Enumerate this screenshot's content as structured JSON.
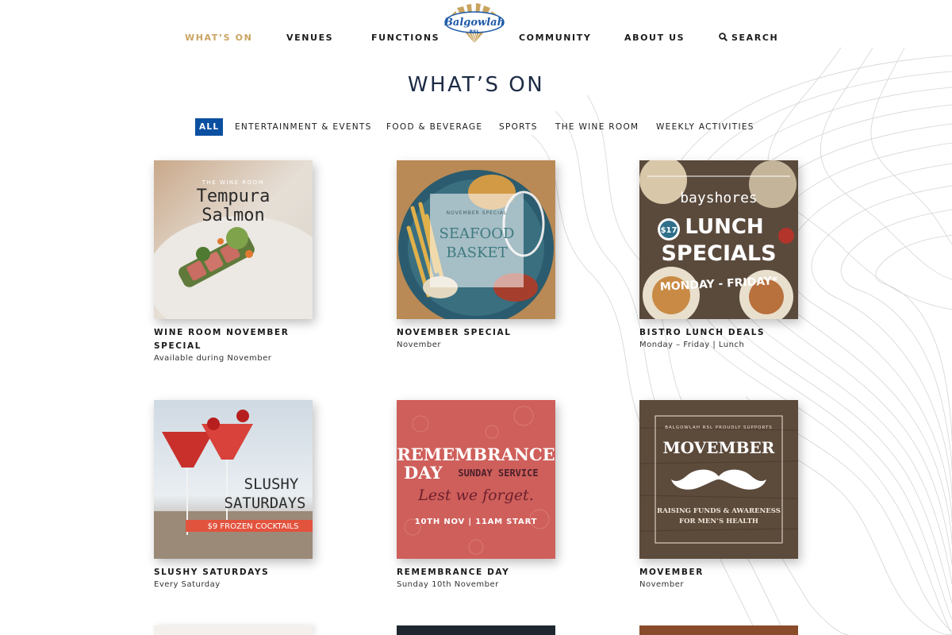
{
  "nav": {
    "items_left": [
      "WHAT’S ON",
      "VENUES",
      "FUNCTIONS"
    ],
    "items_right": [
      "COMMUNITY",
      "ABOUT US"
    ],
    "search_label": "SEARCH",
    "logo_text": "Balgowlah",
    "logo_subtext": "RSL",
    "active_color": "#c9a45f"
  },
  "page": {
    "title": "WHAT’S ON"
  },
  "filters": {
    "items": [
      "ALL",
      "ENTERTAINMENT & EVENTS",
      "FOOD & BEVERAGE",
      "SPORTS",
      "THE WINE ROOM",
      "WEEKLY ACTIVITIES"
    ],
    "active": "ALL",
    "active_color": "#0b4fa0"
  },
  "cards": [
    {
      "title": "WINE ROOM NOVEMBER SPECIAL",
      "subtitle": "Available during November",
      "image": {
        "brand": "THE WINE ROOM",
        "line1": "Tempura",
        "line2": "Salmon"
      }
    },
    {
      "title": "NOVEMBER SPECIAL",
      "subtitle": "November",
      "image": {
        "kicker": "NOVEMBER SPECIAL",
        "line1": "SEAFOOD",
        "line2": "BASKET"
      }
    },
    {
      "title": "BISTRO LUNCH DEALS",
      "subtitle": "Monday – Friday | Lunch",
      "image": {
        "brand": "bayshores",
        "line1": "LUNCH",
        "line2": "SPECIALS",
        "price": "$17",
        "days": "MONDAY - FRIDAY*"
      }
    },
    {
      "title": "SLUSHY SATURDAYS",
      "subtitle": "Every Saturday",
      "image": {
        "line1": "SLUSHY",
        "line2": "SATURDAYS",
        "banner": "$9 FROZEN  COCKTAILS"
      }
    },
    {
      "title": "REMEMBRANCE DAY",
      "subtitle": "Sunday 10th November",
      "image": {
        "line1": "REMEMBRANCE",
        "line2": "DAY",
        "line2b": "SUNDAY SERVICE",
        "script": "Lest we forget.",
        "time": "10TH NOV | 11AM START"
      }
    },
    {
      "title": "MOVEMBER",
      "subtitle": "November",
      "image": {
        "kicker": "BALGOWLAH RSL PROUDLY SUPPORTS",
        "line1": "MOVEMBER",
        "line2": "RAISING FUNDS & AWARENESS",
        "line3": "FOR MEN’S HEALTH"
      }
    }
  ]
}
